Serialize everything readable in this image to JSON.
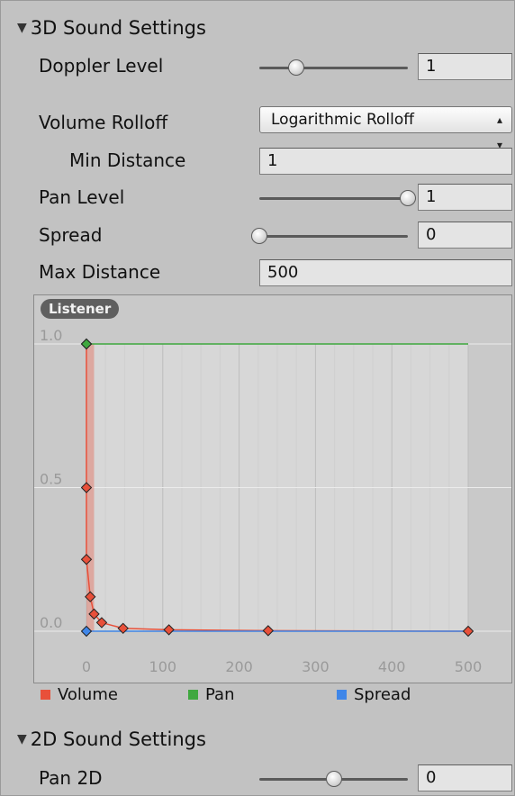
{
  "sections": {
    "three_d": {
      "title": "3D Sound Settings"
    },
    "two_d": {
      "title": "2D Sound Settings"
    }
  },
  "fields": {
    "doppler_level": {
      "label": "Doppler Level",
      "value": "1",
      "slider": 0.25
    },
    "volume_rolloff": {
      "label": "Volume Rolloff",
      "value": "Logarithmic Rolloff"
    },
    "min_distance": {
      "label": "Min Distance",
      "value": "1"
    },
    "pan_level": {
      "label": "Pan Level",
      "value": "1",
      "slider": 1.0
    },
    "spread": {
      "label": "Spread",
      "value": "0",
      "slider": 0.0
    },
    "max_distance": {
      "label": "Max Distance",
      "value": "500"
    },
    "pan_2d": {
      "label": "Pan 2D",
      "value": "0",
      "slider": 0.5
    }
  },
  "graph": {
    "tab_label": "Listener",
    "legend": [
      {
        "name": "Volume",
        "color": "#e8503a"
      },
      {
        "name": "Pan",
        "color": "#3fa83f"
      },
      {
        "name": "Spread",
        "color": "#3f86e8"
      }
    ]
  },
  "chart_data": {
    "type": "line",
    "title": "",
    "xlabel": "",
    "ylabel": "",
    "xlim": [
      0,
      500
    ],
    "ylim": [
      0,
      1
    ],
    "x_ticks": [
      "0",
      "100",
      "200",
      "300",
      "400",
      "500"
    ],
    "y_ticks": [
      "0.0",
      "0.5",
      "1.0"
    ],
    "grid": true,
    "series": [
      {
        "name": "Volume",
        "color": "#e8503a",
        "points": [
          [
            0,
            1.0
          ],
          [
            0,
            0.5
          ],
          [
            0,
            0.25
          ],
          [
            5,
            0.12
          ],
          [
            10,
            0.06
          ],
          [
            20,
            0.03
          ],
          [
            48,
            0.01
          ],
          [
            108,
            0.005
          ],
          [
            238,
            0.002
          ],
          [
            500,
            0.0
          ]
        ]
      },
      {
        "name": "Pan",
        "color": "#3fa83f",
        "points": [
          [
            0,
            1.0
          ],
          [
            500,
            1.0
          ]
        ]
      },
      {
        "name": "Spread",
        "color": "#3f86e8",
        "points": [
          [
            0,
            0.0
          ],
          [
            500,
            0.0
          ]
        ]
      }
    ],
    "keys": [
      {
        "series": "Volume",
        "x": 0,
        "y": 1.0
      },
      {
        "series": "Volume",
        "x": 0,
        "y": 0.5
      },
      {
        "series": "Volume",
        "x": 0,
        "y": 0.25
      },
      {
        "series": "Volume",
        "x": 5,
        "y": 0.12
      },
      {
        "series": "Volume",
        "x": 10,
        "y": 0.06
      },
      {
        "series": "Volume",
        "x": 20,
        "y": 0.03
      },
      {
        "series": "Volume",
        "x": 48,
        "y": 0.01
      },
      {
        "series": "Volume",
        "x": 108,
        "y": 0.005
      },
      {
        "series": "Volume",
        "x": 238,
        "y": 0.002
      },
      {
        "series": "Volume",
        "x": 500,
        "y": 0.0
      },
      {
        "series": "Pan",
        "x": 0,
        "y": 1.0
      },
      {
        "series": "Spread",
        "x": 0,
        "y": 0.0
      }
    ]
  }
}
